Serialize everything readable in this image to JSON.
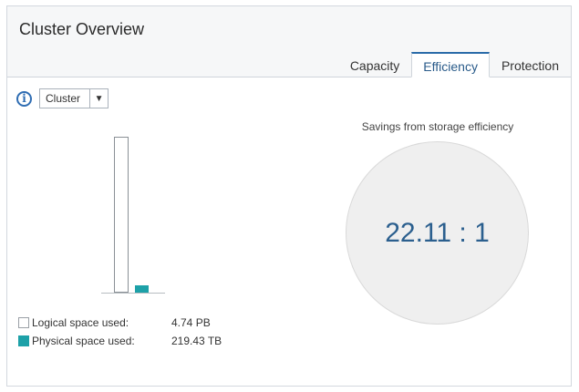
{
  "panel": {
    "title": "Cluster Overview"
  },
  "tabs": [
    {
      "label": "Capacity",
      "active": false
    },
    {
      "label": "Efficiency",
      "active": true
    },
    {
      "label": "Protection",
      "active": false
    }
  ],
  "controls": {
    "info_icon": "info-icon",
    "scope_select": {
      "value": "Cluster",
      "arrow_icon": "chevron-down-icon"
    }
  },
  "chart_data": {
    "type": "bar",
    "series": [
      {
        "name": "Logical space used",
        "value_text": "4.74 PB",
        "value_tb": 4740,
        "color": "#ffffff"
      },
      {
        "name": "Physical space used",
        "value_text": "219.43 TB",
        "value_tb": 219.43,
        "color": "#1da1a8"
      }
    ]
  },
  "legend": [
    {
      "label": "Logical space used:",
      "value": "4.74 PB"
    },
    {
      "label": "Physical space used:",
      "value": "219.43 TB"
    }
  ],
  "savings": {
    "label": "Savings from storage efficiency",
    "ratio": "22.11 : 1"
  }
}
